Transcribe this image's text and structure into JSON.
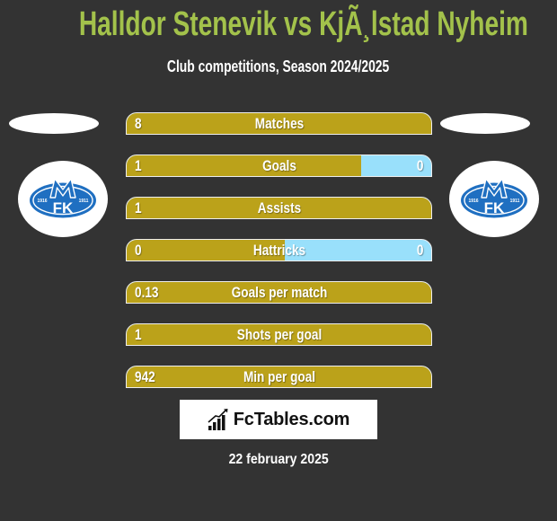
{
  "header": {
    "title": "Halldor Stenevik vs KjÃ¸lstad Nyheim",
    "subtitle": "Club competitions, Season 2024/2025"
  },
  "colors": {
    "background": "#333333",
    "title": "#a3c24b",
    "left_bar": "#bba21a",
    "right_bar": "#99e0fb",
    "crest_blue": "#1f6fc1"
  },
  "teams": {
    "left": {
      "crest": {
        "icon": "molde-fk-crest",
        "initials": "FK",
        "year_left": "1916",
        "year_right": "1911"
      }
    },
    "right": {
      "crest": {
        "icon": "molde-fk-crest",
        "initials": "FK",
        "year_left": "1916",
        "year_right": "1911"
      }
    }
  },
  "stats": [
    {
      "label": "Matches",
      "left": "8",
      "right": "",
      "left_share": 1.0
    },
    {
      "label": "Goals",
      "left": "1",
      "right": "0",
      "left_share": 0.77
    },
    {
      "label": "Assists",
      "left": "1",
      "right": "",
      "left_share": 1.0
    },
    {
      "label": "Hattricks",
      "left": "0",
      "right": "0",
      "left_share": 0.52
    },
    {
      "label": "Goals per match",
      "left": "0.13",
      "right": "",
      "left_share": 1.0
    },
    {
      "label": "Shots per goal",
      "left": "1",
      "right": "",
      "left_share": 1.0
    },
    {
      "label": "Min per goal",
      "left": "942",
      "right": "",
      "left_share": 1.0
    }
  ],
  "branding": {
    "site": "FcTables.com",
    "icon": "bar-chart-trend"
  },
  "date": "22 february 2025"
}
